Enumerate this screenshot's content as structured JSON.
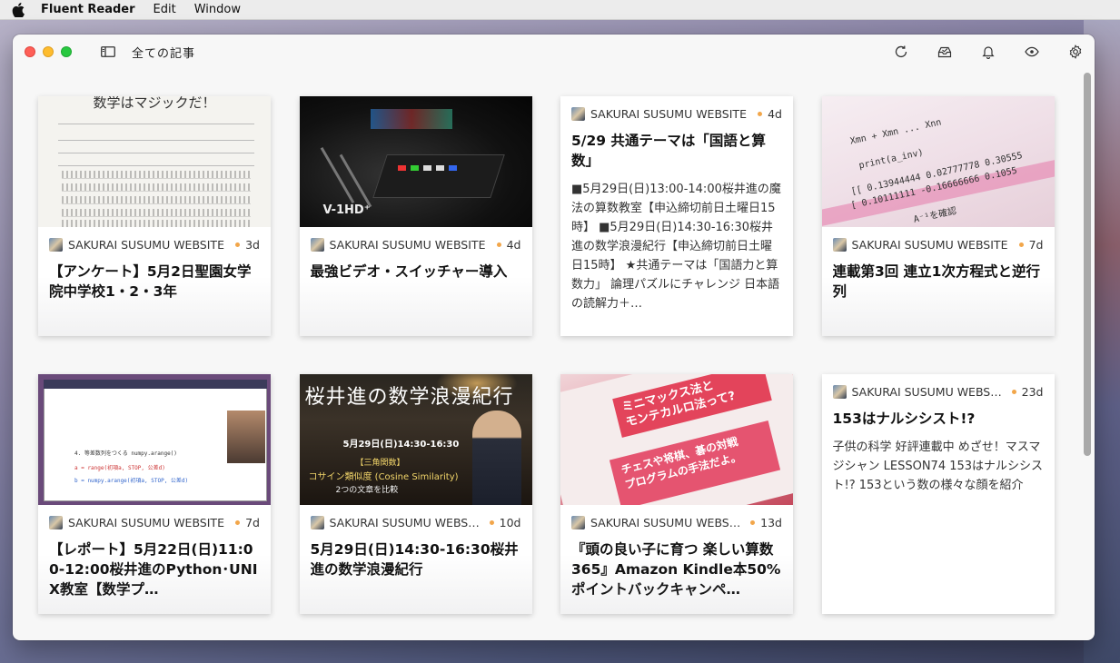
{
  "menubar": {
    "app_name": "Fluent Reader",
    "items": [
      "Edit",
      "Window"
    ]
  },
  "window": {
    "title": "全ての記事",
    "toolbar_icons": [
      "refresh-icon",
      "mark-all-read-icon",
      "notifications-icon",
      "view-icon",
      "settings-icon"
    ]
  },
  "cards": [
    {
      "source": "SAKURAI SUSUMU WEBSITE",
      "age": "3d",
      "title": "【アンケート】5月2日聖園女学院中学校1・2・3年",
      "thumb_text": "数学はマジックだ！",
      "snippet": ""
    },
    {
      "source": "SAKURAI SUSUMU WEBSITE",
      "age": "4d",
      "title": "最強ビデオ・スイッチャー導入",
      "thumb_text": "V-1HD⁺",
      "snippet": ""
    },
    {
      "source": "SAKURAI SUSUMU WEBSITE",
      "age": "4d",
      "title": "5/29 共通テーマは「国語と算数」",
      "snippet": "■5月29日(日)13:00-14:00桜井進の魔法の算数教室【申込締切前日土曜日15時】 ■5月29日(日)14:30-16:30桜井進の数学浪漫紀行【申込締切前日土曜日15時】 ★共通テーマは「国語力と算数力」 論理パズルにチャレンジ 日本語の読解力＋…"
    },
    {
      "source": "SAKURAI SUSUMU WEBSITE",
      "age": "7d",
      "title": "連載第3回 連立1次方程式と逆行列",
      "snippet": ""
    },
    {
      "source": "SAKURAI SUSUMU WEBSITE",
      "age": "7d",
      "title": "【レポート】5月22日(日)11:00-12:00桜井進のPython･UNIX教室【数学プ…",
      "snippet": ""
    },
    {
      "source": "SAKURAI SUSUMU WEBSI…",
      "age": "10d",
      "title": "5月29日(日)14:30-16:30桜井進の数学浪漫紀行",
      "thumb_text": "桜井進の数学浪漫紀行",
      "snippet": ""
    },
    {
      "source": "SAKURAI SUSUMU WEBSI…",
      "age": "13d",
      "title": "『頭の良い子に育つ 楽しい算数365』Amazon Kindle本50%ポイントバックキャンペ…",
      "snippet": ""
    },
    {
      "source": "SAKURAI SUSUMU WEBSI…",
      "age": "23d",
      "title": "153はナルシシスト!?",
      "snippet": "子供の科学 好評連載中 めざせ！マスマジシャン LESSON74 153はナルシシスト!? 153という数の様々な顔を紹介"
    }
  ]
}
